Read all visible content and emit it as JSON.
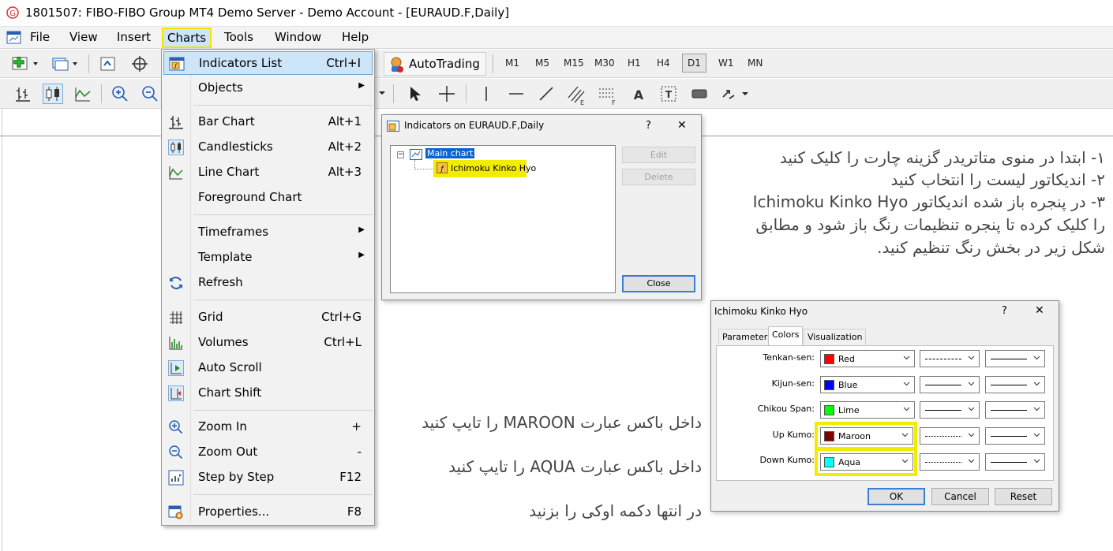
{
  "window": {
    "title": "1801507: FIBO-FIBO Group MT4 Demo Server - Demo Account - [EURAUD.F,Daily]"
  },
  "menubar": {
    "items": [
      "File",
      "View",
      "Insert",
      "Charts",
      "Tools",
      "Window",
      "Help"
    ]
  },
  "toolbar": {
    "autotrading": "AutoTrading",
    "timeframes": [
      "M1",
      "M5",
      "M15",
      "M30",
      "H1",
      "H4",
      "D1",
      "W1",
      "MN"
    ],
    "active_timeframe": "D1"
  },
  "charts_menu": {
    "items": [
      {
        "label": "Indicators List",
        "shortcut": "Ctrl+I",
        "icon": "indicators-list-icon"
      },
      {
        "label": "Objects",
        "submenu": true
      },
      {
        "label": "Bar Chart",
        "shortcut": "Alt+1",
        "icon": "bar-chart-icon"
      },
      {
        "label": "Candlesticks",
        "shortcut": "Alt+2",
        "icon": "candlesticks-icon"
      },
      {
        "label": "Line Chart",
        "shortcut": "Alt+3",
        "icon": "line-chart-icon"
      },
      {
        "label": "Foreground Chart"
      },
      {
        "label": "Timeframes",
        "submenu": true
      },
      {
        "label": "Template",
        "submenu": true
      },
      {
        "label": "Refresh",
        "icon": "refresh-icon"
      },
      {
        "label": "Grid",
        "shortcut": "Ctrl+G",
        "icon": "grid-icon"
      },
      {
        "label": "Volumes",
        "shortcut": "Ctrl+L",
        "icon": "volumes-icon"
      },
      {
        "label": "Auto Scroll",
        "icon": "auto-scroll-icon"
      },
      {
        "label": "Chart Shift",
        "icon": "chart-shift-icon"
      },
      {
        "label": "Zoom In",
        "shortcut": "+",
        "icon": "zoom-in-icon"
      },
      {
        "label": "Zoom Out",
        "shortcut": "-",
        "icon": "zoom-out-icon"
      },
      {
        "label": "Step by Step",
        "shortcut": "F12",
        "icon": "step-by-step-icon"
      },
      {
        "label": "Properties...",
        "shortcut": "F8",
        "icon": "properties-icon"
      }
    ]
  },
  "indicators_dialog": {
    "title": "Indicators on EURAUD.F,Daily",
    "help": "?",
    "close_x": "✕",
    "tree_root": "Main chart",
    "tree_child": "Ichimoku Kinko Hyo",
    "edit": "Edit",
    "delete": "Delete",
    "close": "Close"
  },
  "ichimoku_dialog": {
    "title": "Ichimoku Kinko Hyo",
    "help": "?",
    "close_x": "✕",
    "tabs": [
      "Parameters",
      "Colors",
      "Visualization"
    ],
    "rows": [
      {
        "label": "Tenkan-sen:",
        "color_name": "Red",
        "swatch": "#ff0000"
      },
      {
        "label": "Kijun-sen:",
        "color_name": "Blue",
        "swatch": "#0000ff"
      },
      {
        "label": "Chikou Span:",
        "color_name": "Lime",
        "swatch": "#00ff00"
      },
      {
        "label": "Up Kumo:",
        "color_name": "Maroon",
        "swatch": "#800000"
      },
      {
        "label": "Down Kumo:",
        "color_name": "Aqua",
        "swatch": "#00ffff"
      }
    ],
    "ok": "OK",
    "cancel": "Cancel",
    "reset": "Reset"
  },
  "notes": {
    "line1": "۱- ابتدا در منوی متاتریدر گزینه چارت را کلیک کنید",
    "line2": "۲- اندیکاتور لیست را انتخاب کنید",
    "line3": "۳- در پنجره باز شده اندیکاتور Ichimoku Kinko Hyo",
    "line4": "را کلیک کرده تا پنجره تنظیمات رنگ باز شود و مطابق",
    "line5": "شکل زیر در بخش رنگ تنظیم کنید.",
    "maroon": "داخل باکس عبارت MAROON را تایپ کنید",
    "aqua": "داخل باکس عبارت AQUA را تایپ کنید",
    "ok": "در انتها دکمه اوکی را بزنید"
  },
  "colors": {
    "highlight": "#f2ec00",
    "menu_hover": "#cde5f8",
    "selection": "#0a64d2"
  }
}
